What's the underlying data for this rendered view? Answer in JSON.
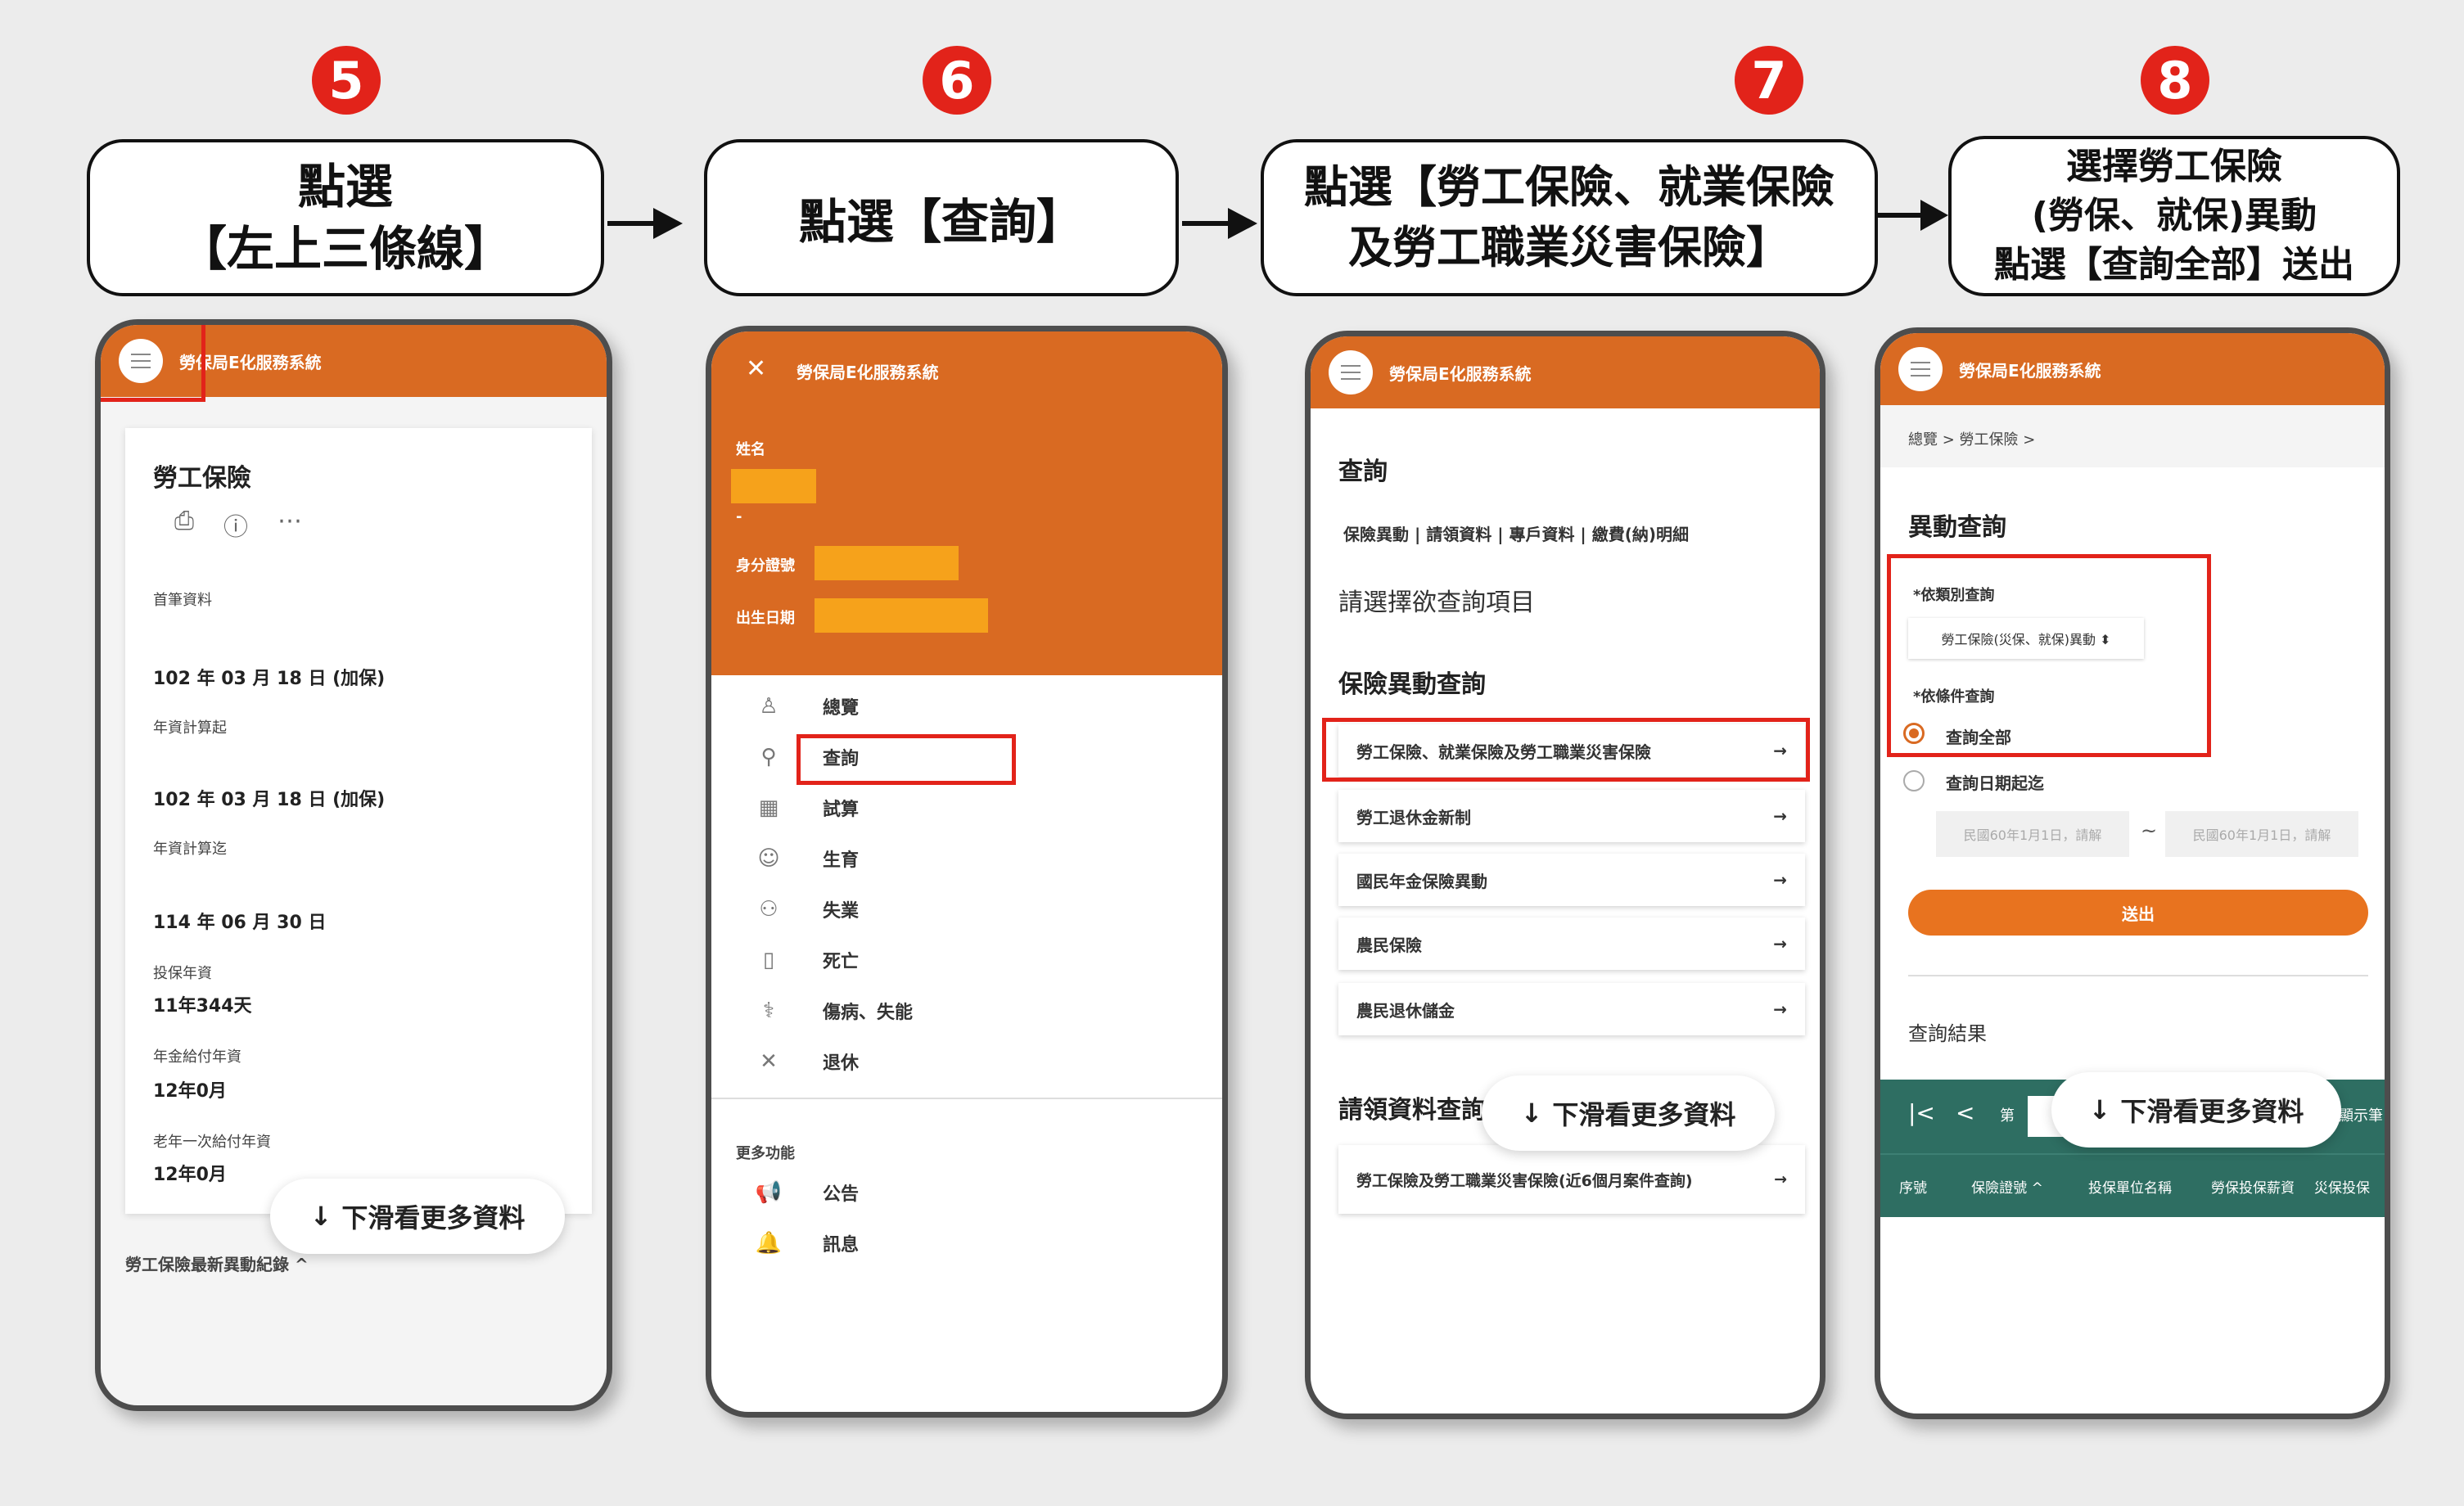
{
  "steps": [
    {
      "number": "5",
      "line1": "點選",
      "line2": "【左上三條線】"
    },
    {
      "number": "6",
      "line1": "點選【查詢】"
    },
    {
      "number": "7",
      "line1": "點選【勞工保險、就業保險",
      "line2": "及勞工職業災害保險】"
    },
    {
      "number": "8",
      "line1": "選擇勞工保險",
      "line2": "(勞保、就保)異動",
      "line3": "點選【查詢全部】送出"
    }
  ],
  "app_title": "勞保局E化服務系統",
  "scroll_hint": "下滑看更多資料",
  "phone1": {
    "card_title": "勞工保險",
    "rows": [
      {
        "label": "首筆資料",
        "value": ""
      },
      {
        "label": "",
        "value": "102 年 03 月 18 日 (加保)"
      },
      {
        "label": "年資計算起",
        "value": ""
      },
      {
        "label": "",
        "value": "102 年 03 月 18 日 (加保)"
      },
      {
        "label": "年資計算迄",
        "value": ""
      },
      {
        "label": "",
        "value": "114 年 06 月 30 日"
      },
      {
        "label": "投保年資",
        "value": "11年344天"
      },
      {
        "label": "年金給付年資",
        "value": "12年0月"
      },
      {
        "label": "老年一次給付年資",
        "value": "12年0月"
      }
    ],
    "footer": "勞工保險最新異動紀錄 ^"
  },
  "phone2": {
    "name_label": "姓名",
    "dash": "-",
    "id_label": "身分證號",
    "birth_label": "出生日期",
    "menu": [
      {
        "icon": "♙",
        "label": "總覽"
      },
      {
        "icon": "⚲",
        "label": "查詢"
      },
      {
        "icon": "▦",
        "label": "試算"
      },
      {
        "icon": "☺",
        "label": "生育"
      },
      {
        "icon": "⚇",
        "label": "失業"
      },
      {
        "icon": "▯",
        "label": "死亡"
      },
      {
        "icon": "⚕",
        "label": "傷病、失能"
      },
      {
        "icon": "✕",
        "label": "退休"
      }
    ],
    "more_label": "更多功能",
    "more": [
      {
        "icon": "📢",
        "label": "公告"
      },
      {
        "icon": "🔔",
        "label": "訊息"
      }
    ]
  },
  "phone3": {
    "section": "查詢",
    "tabs": "保險異動 | 請領資料 | 專戶資料 | 繳費(納)明細",
    "prompt": "請選擇欲查詢項目",
    "subsection": "保險異動查詢",
    "items": [
      "勞工保險、就業保險及勞工職業災害保險",
      "勞工退休金新制",
      "國民年金保險異動",
      "農民保險",
      "農民退休儲金"
    ],
    "claims_section": "請領資料查詢",
    "claims_item": "勞工保險及勞工職業災害保險(近6個月案件查詢)"
  },
  "phone4": {
    "breadcrumb": "總覽  >  勞工保險  >",
    "title": "異動查詢",
    "category_label": "*依類別查詢",
    "category_value": "勞工保險(災保、就保)異動 ⬍",
    "condition_label": "*依條件查詢",
    "opt_all": "查詢全部",
    "opt_range": "查詢日期起迄",
    "date_from": "民國60年1月1日，請解",
    "tilde": "~",
    "date_to": "民國60年1月1日，請解",
    "submit": "送出",
    "results": "查詢結果",
    "pager_first": "|<",
    "pager_prev": "<",
    "pager_page": "第",
    "pager_show": "顯示筆",
    "table_headers": [
      "序號",
      "保險證號 ^",
      "投保單位名稱",
      "勞保投保薪資",
      "災保投保"
    ]
  }
}
